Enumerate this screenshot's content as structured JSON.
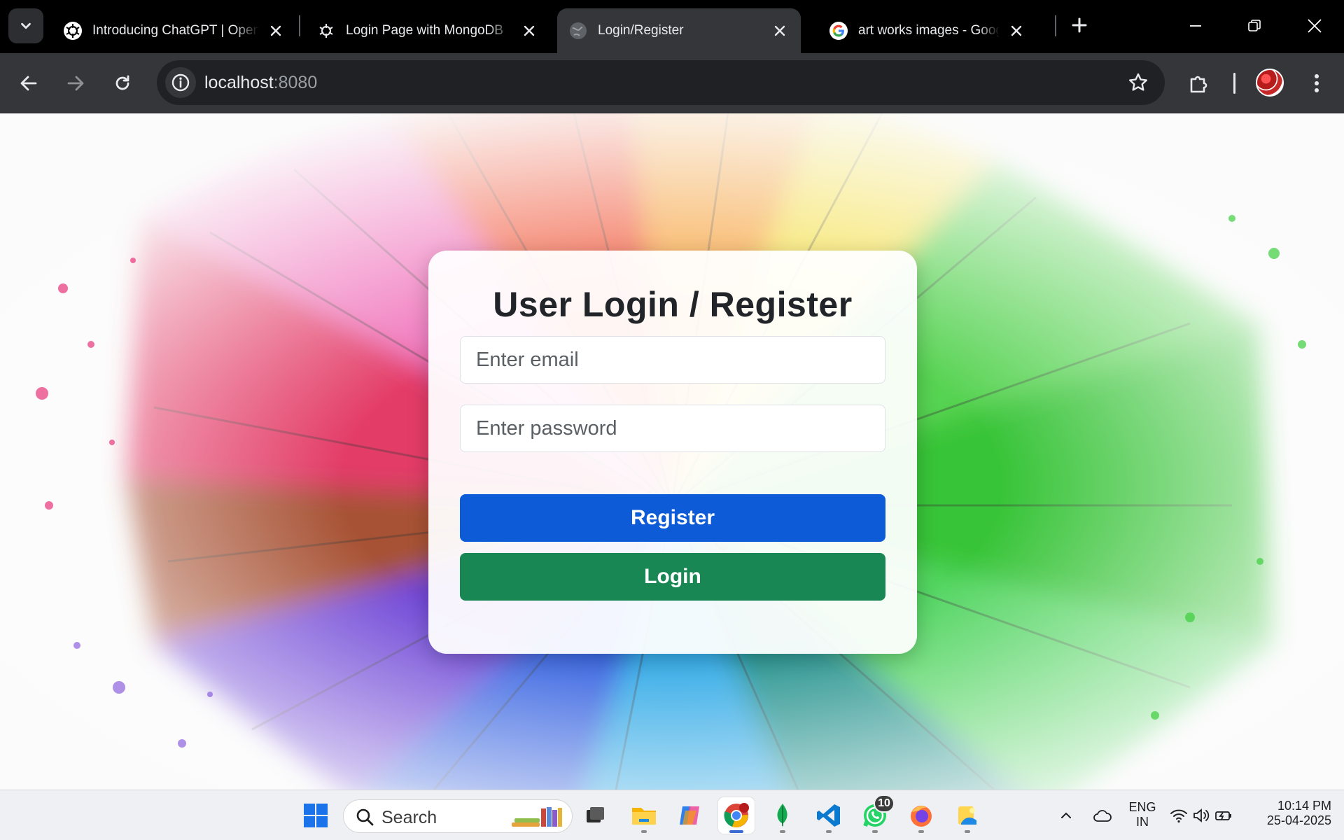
{
  "browser": {
    "tabs": [
      {
        "title": "Introducing ChatGPT | OpenAI",
        "active": false
      },
      {
        "title": "Login Page with MongoDB",
        "active": false
      },
      {
        "title": "Login/Register",
        "active": true
      },
      {
        "title": "art works images - Google Search",
        "active": false
      }
    ],
    "address": {
      "host": "localhost",
      "port": ":8080"
    }
  },
  "page": {
    "heading": "User Login / Register",
    "email_placeholder": "Enter email",
    "password_placeholder": "Enter password",
    "register_label": "Register",
    "login_label": "Login",
    "colors": {
      "register": "#0d5bd7",
      "login": "#198754"
    }
  },
  "taskbar": {
    "search_label": "Search",
    "whatsapp_badge": "10",
    "language_line1": "ENG",
    "language_line2": "IN",
    "time": "10:14 PM",
    "date": "25-04-2025"
  }
}
